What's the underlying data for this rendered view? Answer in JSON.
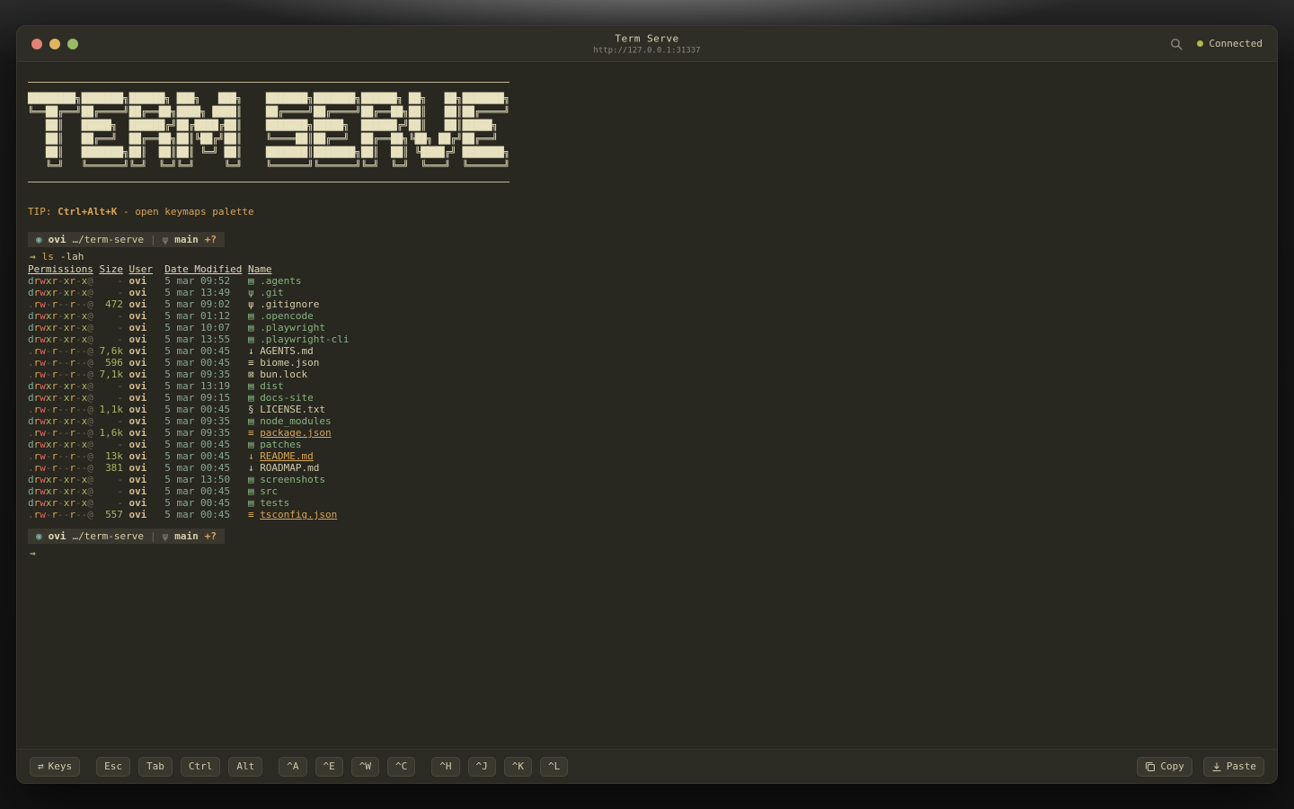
{
  "window": {
    "title": "Term Serve",
    "url": "http://127.0.0.1:31337",
    "status_label": "Connected"
  },
  "banner": {
    "lines": [
      "████████╗███████╗██████╗ ███╗   ███╗    ███████╗███████╗██████╗ ██╗   ██╗███████╗",
      "╚══██╔══╝██╔════╝██╔══██╗████╗ ████║    ██╔════╝██╔════╝██╔══██╗██║   ██║██╔════╝",
      "   ██║   █████╗  ██████╔╝██╔████╔██║    ███████╗█████╗  ██████╔╝██║   ██║█████╗  ",
      "   ██║   ██╔══╝  ██╔══██╗██║╚██╔╝██║    ╚════██║██╔══╝  ██╔══██╗╚██╗ ██╔╝██╔══╝  ",
      "   ██║   ███████╗██║  ██║██║ ╚═╝ ██║    ███████║███████╗██║  ██║ ╚████╔╝ ███████╗",
      "   ╚═╝   ╚══════╝╚═╝  ╚═╝╚═╝     ╚═╝    ╚══════╝╚══════╝╚═╝  ╚═╝  ╚═══╝  ╚══════╝"
    ]
  },
  "tip": {
    "prefix": "TIP:",
    "key": "Ctrl+Alt+K",
    "rest": "- open keymaps palette"
  },
  "prompt": {
    "icon": "◉",
    "user": "ovi",
    "path": "…/term-serve",
    "separator": "|",
    "branch_icon": "ψ",
    "branch": "main",
    "git_status": "+?"
  },
  "command": {
    "arrow": "→",
    "name": "ls",
    "args": "-lah"
  },
  "icons": {
    "folder": "▤",
    "git": "ψ",
    "markdown": "↓",
    "json": "≡",
    "lock": "⊠",
    "text": "§",
    "keys": "⇄"
  },
  "listing": {
    "headers": [
      "Permissions",
      "Size",
      "User",
      "Date Modified",
      "Name"
    ],
    "rows": [
      {
        "perms": "drwxr-xr-x@",
        "size": "-",
        "user": "ovi",
        "date": "5 mar 09:52",
        "icon": "folder",
        "name": ".agents",
        "kind": "dir"
      },
      {
        "perms": "drwxr-xr-x@",
        "size": "-",
        "user": "ovi",
        "date": "5 mar 13:49",
        "icon": "git",
        "name": ".git",
        "kind": "dir"
      },
      {
        "perms": ".rw-r--r--@",
        "size": "472",
        "user": "ovi",
        "date": "5 mar 09:02",
        "icon": "git",
        "name": ".gitignore",
        "kind": "file"
      },
      {
        "perms": "drwxr-xr-x@",
        "size": "-",
        "user": "ovi",
        "date": "5 mar 01:12",
        "icon": "folder",
        "name": ".opencode",
        "kind": "dir"
      },
      {
        "perms": "drwxr-xr-x@",
        "size": "-",
        "user": "ovi",
        "date": "5 mar 10:07",
        "icon": "folder",
        "name": ".playwright",
        "kind": "dir"
      },
      {
        "perms": "drwxr-xr-x@",
        "size": "-",
        "user": "ovi",
        "date": "5 mar 13:55",
        "icon": "folder",
        "name": ".playwright-cli",
        "kind": "dir"
      },
      {
        "perms": ".rw-r--r--@",
        "size": "7,6k",
        "user": "ovi",
        "date": "5 mar 00:45",
        "icon": "markdown",
        "name": "AGENTS.md",
        "kind": "file"
      },
      {
        "perms": ".rw-r--r--@",
        "size": "596",
        "user": "ovi",
        "date": "5 mar 00:45",
        "icon": "json",
        "name": "biome.json",
        "kind": "file"
      },
      {
        "perms": ".rw-r--r--@",
        "size": "7,1k",
        "user": "ovi",
        "date": "5 mar 09:35",
        "icon": "lock",
        "name": "bun.lock",
        "kind": "file"
      },
      {
        "perms": "drwxr-xr-x@",
        "size": "-",
        "user": "ovi",
        "date": "5 mar 13:19",
        "icon": "folder",
        "name": "dist",
        "kind": "dir"
      },
      {
        "perms": "drwxr-xr-x@",
        "size": "-",
        "user": "ovi",
        "date": "5 mar 09:15",
        "icon": "folder",
        "name": "docs-site",
        "kind": "dir"
      },
      {
        "perms": ".rw-r--r--@",
        "size": "1,1k",
        "user": "ovi",
        "date": "5 mar 00:45",
        "icon": "text",
        "name": "LICENSE.txt",
        "kind": "file"
      },
      {
        "perms": "drwxr-xr-x@",
        "size": "-",
        "user": "ovi",
        "date": "5 mar 09:35",
        "icon": "folder",
        "name": "node_modules",
        "kind": "dir"
      },
      {
        "perms": ".rw-r--r--@",
        "size": "1,6k",
        "user": "ovi",
        "date": "5 mar 09:35",
        "icon": "json",
        "name": "package.json",
        "kind": "modified"
      },
      {
        "perms": "drwxr-xr-x@",
        "size": "-",
        "user": "ovi",
        "date": "5 mar 00:45",
        "icon": "folder",
        "name": "patches",
        "kind": "dir"
      },
      {
        "perms": ".rw-r--r--@",
        "size": "13k",
        "user": "ovi",
        "date": "5 mar 00:45",
        "icon": "markdown",
        "name": "README.md",
        "kind": "modified"
      },
      {
        "perms": ".rw-r--r--@",
        "size": "381",
        "user": "ovi",
        "date": "5 mar 00:45",
        "icon": "markdown",
        "name": "ROADMAP.md",
        "kind": "file"
      },
      {
        "perms": "drwxr-xr-x@",
        "size": "-",
        "user": "ovi",
        "date": "5 mar 13:50",
        "icon": "folder",
        "name": "screenshots",
        "kind": "dir"
      },
      {
        "perms": "drwxr-xr-x@",
        "size": "-",
        "user": "ovi",
        "date": "5 mar 00:45",
        "icon": "folder",
        "name": "src",
        "kind": "dir"
      },
      {
        "perms": "drwxr-xr-x@",
        "size": "-",
        "user": "ovi",
        "date": "5 mar 00:45",
        "icon": "folder",
        "name": "tests",
        "kind": "dir"
      },
      {
        "perms": ".rw-r--r--@",
        "size": "557",
        "user": "ovi",
        "date": "5 mar 00:45",
        "icon": "json",
        "name": "tsconfig.json",
        "kind": "modified"
      }
    ]
  },
  "toolbar": {
    "keys_button": "Keys",
    "key_buttons": [
      "Esc",
      "Tab",
      "Ctrl",
      "Alt"
    ],
    "ctrl_group_1": [
      "^A",
      "^E",
      "^W",
      "^C"
    ],
    "ctrl_group_2": [
      "^H",
      "^J",
      "^K",
      "^L"
    ],
    "copy": "Copy",
    "paste": "Paste"
  },
  "colors": {
    "desktop_bg": "#161616",
    "window_bg": "#282720",
    "titlebar_bg": "#2e2d26",
    "toolbar_bg": "#2b2a23",
    "border": "#3a382d",
    "rule": "#bdb695",
    "text": "#d4cdab",
    "banner": "#e7e1bf",
    "yellow": "#d8a657",
    "green": "#a9b665",
    "red": "#ea6962",
    "blue": "#7daea3",
    "dir": "#89b482",
    "dim": "#6b6557",
    "muted": "#8d897b",
    "user": "#d3be93",
    "date": "#8aa794",
    "prompt_bar_bg": "#3a382e",
    "button_bg": "#39382f",
    "button_border": "#494738",
    "connected_dot": "#b3b94b",
    "traffic_close": "#e28378",
    "traffic_min": "#e0b35f",
    "traffic_zoom": "#9aba65"
  }
}
